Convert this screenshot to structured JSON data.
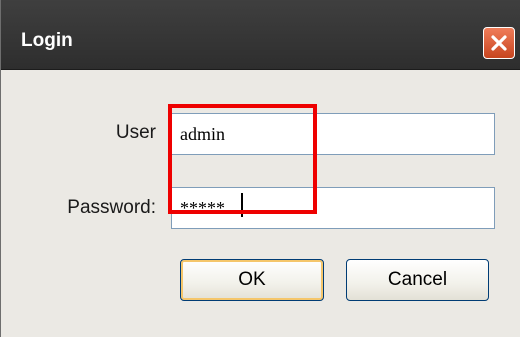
{
  "window": {
    "title": "Login",
    "close_icon": "close-icon"
  },
  "form": {
    "user_label": "User",
    "user_value": "admin",
    "password_label": "Password:",
    "password_value": "*****"
  },
  "buttons": {
    "ok_label": "OK",
    "cancel_label": "Cancel"
  },
  "colors": {
    "titlebar": "#333333",
    "close_button": "#e05a30",
    "highlight": "#ee0000",
    "dialog_background": "#ebe9e4"
  }
}
